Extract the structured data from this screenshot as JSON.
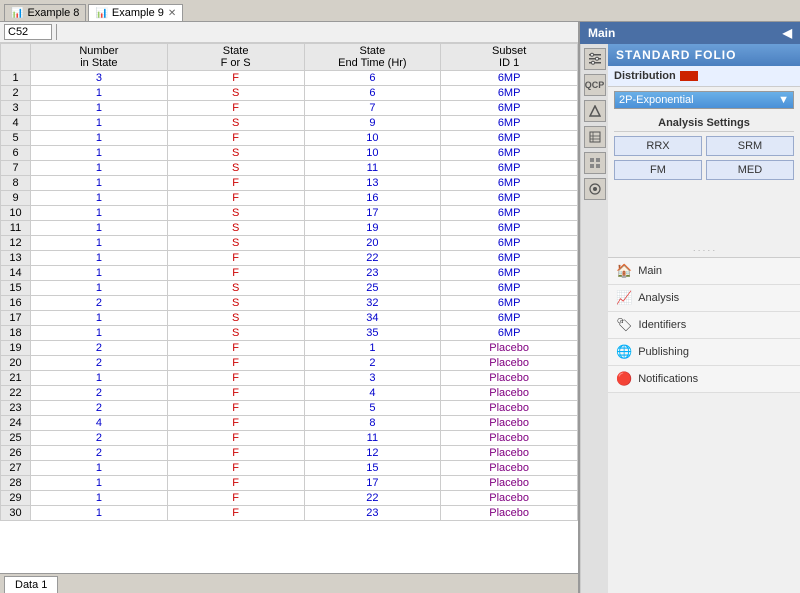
{
  "tabs": [
    {
      "id": "ex8",
      "label": "Example 8",
      "icon": "📊",
      "closable": false
    },
    {
      "id": "ex9",
      "label": "Example 9",
      "icon": "📊",
      "closable": true,
      "active": true
    }
  ],
  "cellRef": "C52",
  "columns": [
    {
      "id": "number_in_state",
      "line1": "Number",
      "line2": "in State"
    },
    {
      "id": "state_f_or_s",
      "line1": "State",
      "line2": "F or S"
    },
    {
      "id": "state_end_time",
      "line1": "State",
      "line2": "End Time (Hr)"
    },
    {
      "id": "subset_id1",
      "line1": "Subset",
      "line2": "ID 1"
    }
  ],
  "rows": [
    {
      "rowNum": 1,
      "numInState": "3",
      "stateFS": "F",
      "endTime": "6",
      "subsetID": "6MP"
    },
    {
      "rowNum": 2,
      "numInState": "1",
      "stateFS": "S",
      "endTime": "6",
      "subsetID": "6MP"
    },
    {
      "rowNum": 3,
      "numInState": "1",
      "stateFS": "F",
      "endTime": "7",
      "subsetID": "6MP"
    },
    {
      "rowNum": 4,
      "numInState": "1",
      "stateFS": "S",
      "endTime": "9",
      "subsetID": "6MP"
    },
    {
      "rowNum": 5,
      "numInState": "1",
      "stateFS": "F",
      "endTime": "10",
      "subsetID": "6MP"
    },
    {
      "rowNum": 6,
      "numInState": "1",
      "stateFS": "S",
      "endTime": "10",
      "subsetID": "6MP"
    },
    {
      "rowNum": 7,
      "numInState": "1",
      "stateFS": "S",
      "endTime": "11",
      "subsetID": "6MP"
    },
    {
      "rowNum": 8,
      "numInState": "1",
      "stateFS": "F",
      "endTime": "13",
      "subsetID": "6MP"
    },
    {
      "rowNum": 9,
      "numInState": "1",
      "stateFS": "F",
      "endTime": "16",
      "subsetID": "6MP"
    },
    {
      "rowNum": 10,
      "numInState": "1",
      "stateFS": "S",
      "endTime": "17",
      "subsetID": "6MP"
    },
    {
      "rowNum": 11,
      "numInState": "1",
      "stateFS": "S",
      "endTime": "19",
      "subsetID": "6MP"
    },
    {
      "rowNum": 12,
      "numInState": "1",
      "stateFS": "S",
      "endTime": "20",
      "subsetID": "6MP"
    },
    {
      "rowNum": 13,
      "numInState": "1",
      "stateFS": "F",
      "endTime": "22",
      "subsetID": "6MP"
    },
    {
      "rowNum": 14,
      "numInState": "1",
      "stateFS": "F",
      "endTime": "23",
      "subsetID": "6MP"
    },
    {
      "rowNum": 15,
      "numInState": "1",
      "stateFS": "S",
      "endTime": "25",
      "subsetID": "6MP"
    },
    {
      "rowNum": 16,
      "numInState": "2",
      "stateFS": "S",
      "endTime": "32",
      "subsetID": "6MP"
    },
    {
      "rowNum": 17,
      "numInState": "1",
      "stateFS": "S",
      "endTime": "34",
      "subsetID": "6MP"
    },
    {
      "rowNum": 18,
      "numInState": "1",
      "stateFS": "S",
      "endTime": "35",
      "subsetID": "6MP"
    },
    {
      "rowNum": 19,
      "numInState": "2",
      "stateFS": "F",
      "endTime": "1",
      "subsetID": "Placebo"
    },
    {
      "rowNum": 20,
      "numInState": "2",
      "stateFS": "F",
      "endTime": "2",
      "subsetID": "Placebo"
    },
    {
      "rowNum": 21,
      "numInState": "1",
      "stateFS": "F",
      "endTime": "3",
      "subsetID": "Placebo"
    },
    {
      "rowNum": 22,
      "numInState": "2",
      "stateFS": "F",
      "endTime": "4",
      "subsetID": "Placebo"
    },
    {
      "rowNum": 23,
      "numInState": "2",
      "stateFS": "F",
      "endTime": "5",
      "subsetID": "Placebo"
    },
    {
      "rowNum": 24,
      "numInState": "4",
      "stateFS": "F",
      "endTime": "8",
      "subsetID": "Placebo"
    },
    {
      "rowNum": 25,
      "numInState": "2",
      "stateFS": "F",
      "endTime": "11",
      "subsetID": "Placebo"
    },
    {
      "rowNum": 26,
      "numInState": "2",
      "stateFS": "F",
      "endTime": "12",
      "subsetID": "Placebo"
    },
    {
      "rowNum": 27,
      "numInState": "1",
      "stateFS": "F",
      "endTime": "15",
      "subsetID": "Placebo"
    },
    {
      "rowNum": 28,
      "numInState": "1",
      "stateFS": "F",
      "endTime": "17",
      "subsetID": "Placebo"
    },
    {
      "rowNum": 29,
      "numInState": "1",
      "stateFS": "F",
      "endTime": "22",
      "subsetID": "Placebo"
    },
    {
      "rowNum": 30,
      "numInState": "1",
      "stateFS": "F",
      "endTime": "23",
      "subsetID": "Placebo"
    }
  ],
  "bottomTabs": [
    "Data 1"
  ],
  "rightPanel": {
    "title": "Main",
    "pinIcon": "📌",
    "folioTitle": "Standard Folio",
    "distributionLabel": "Distribution",
    "selectedDistribution": "2P-Exponential",
    "analysisSettingsTitle": "Analysis Settings",
    "analysisButtons": [
      "RRX",
      "SRM",
      "FM",
      "MED"
    ],
    "navItems": [
      {
        "id": "main",
        "label": "Main",
        "icon": "🏠"
      },
      {
        "id": "analysis",
        "label": "Analysis",
        "icon": "📈"
      },
      {
        "id": "identifiers",
        "label": "Identifiers",
        "icon": "🏷"
      },
      {
        "id": "publishing",
        "label": "Publishing",
        "icon": "🌐"
      },
      {
        "id": "notifications",
        "label": "Notifications",
        "icon": "🔔"
      }
    ]
  },
  "icons": {
    "sidebarIcons": [
      "⚙",
      "⚙",
      "▲",
      "≡",
      "▦",
      "◎"
    ]
  }
}
